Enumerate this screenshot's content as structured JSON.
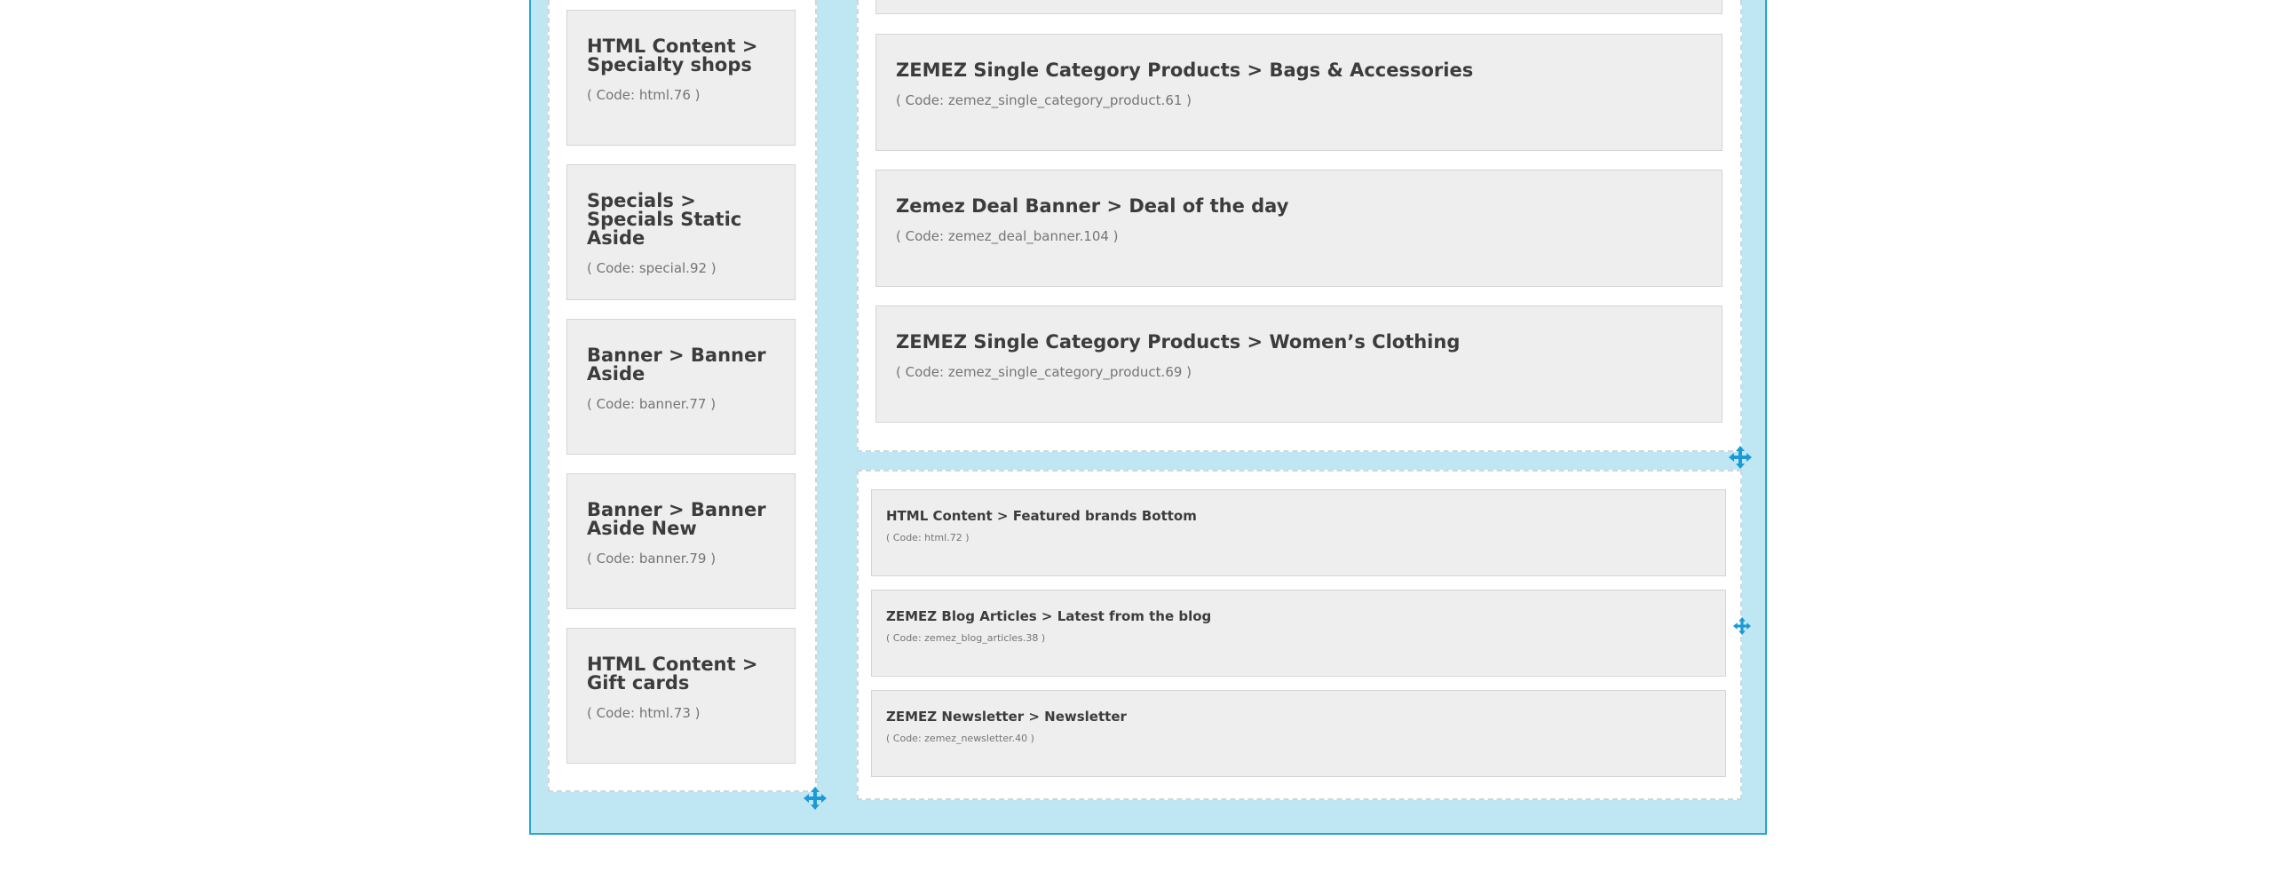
{
  "left_column": {
    "modules": [
      {
        "title": "HTML Content > Specialty shops",
        "code": "( Code: html.76 )"
      },
      {
        "title": "Specials > Specials Static Aside",
        "code": "( Code: special.92 )"
      },
      {
        "title": "Banner > Banner Aside",
        "code": "( Code: banner.77 )"
      },
      {
        "title": "Banner > Banner Aside New",
        "code": "( Code: banner.79 )"
      },
      {
        "title": "HTML Content > Gift cards",
        "code": "( Code: html.73 )"
      }
    ]
  },
  "right_column_top": {
    "modules": [
      {
        "title": "ZEMEZ Single Category Products > Bags & Accessories",
        "code": "( Code: zemez_single_category_product.61 )"
      },
      {
        "title": "Zemez Deal Banner > Deal of the day",
        "code": "( Code: zemez_deal_banner.104 )"
      },
      {
        "title": "ZEMEZ Single Category Products > Women’s Clothing",
        "code": "( Code: zemez_single_category_product.69 )"
      }
    ]
  },
  "right_column_bottom": {
    "modules": [
      {
        "title": "HTML Content > Featured brands Bottom",
        "code": "( Code: html.72 )"
      },
      {
        "title": "ZEMEZ Blog Articles > Latest from the blog",
        "code": "( Code: zemez_blog_articles.38 )"
      },
      {
        "title": "ZEMEZ Newsletter > Newsletter",
        "code": "( Code: zemez_newsletter.40 )"
      }
    ]
  },
  "icons": {
    "drag": "move-arrows-icon",
    "accent_color": "#1a9ad6"
  }
}
